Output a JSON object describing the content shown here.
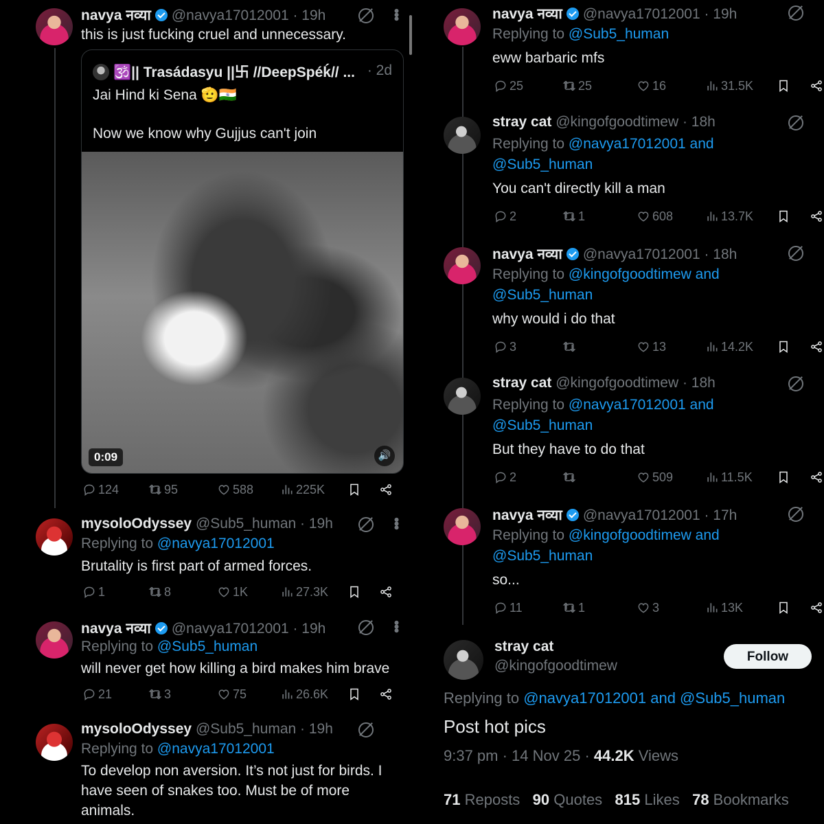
{
  "icons": {
    "reply": "reply-icon",
    "repost": "repost-icon",
    "like": "like-icon",
    "views": "views-icon",
    "bookmark": "bookmark-icon",
    "share": "share-icon",
    "grok": "grok-icon",
    "more": "more-icon"
  },
  "colors": {
    "background": "#000000",
    "text": "#e7e9ea",
    "muted": "#71767b",
    "link": "#1d9bf0",
    "verified": "#1d9bf0",
    "follow_button": "#eff3f4"
  },
  "left": {
    "post1": {
      "name": "navya नव्या",
      "handle": "@navya17012001 · 19h",
      "text": "this is just fucking cruel and unnecessary.",
      "quote": {
        "author": "🕉️|| Trasádasyu ||卐 //DeepSpéḱ// ...",
        "time": "· 2d",
        "text_line1": "Jai Hind ki Sena 🫡🇮🇳",
        "text_line2": "Now we know why Gujjus can't join",
        "video_time": "0:09"
      },
      "stats": {
        "replies": "124",
        "reposts": "95",
        "likes": "588",
        "views": "225K"
      }
    },
    "post2": {
      "name": "mysoloOdyssey",
      "handle": "@Sub5_human · 19h",
      "replying_label": "Replying to",
      "replying_to": "@navya17012001",
      "text": "Brutality is first part of armed forces.",
      "stats": {
        "replies": "1",
        "reposts": "8",
        "likes": "1K",
        "views": "27.3K"
      }
    },
    "post3": {
      "name": "navya नव्या",
      "handle": "@navya17012001 · 19h",
      "replying_label": "Replying to",
      "replying_to": "@Sub5_human",
      "text": "will never get how killing a bird makes him brave",
      "stats": {
        "replies": "21",
        "reposts": "3",
        "likes": "75",
        "views": "26.6K"
      }
    },
    "post4": {
      "name": "mysoloOdyssey",
      "handle": "@Sub5_human · 19h",
      "replying_label": "Replying to",
      "replying_to": "@navya17012001",
      "text_line1": "To develop non aversion. It’s not just for birds. I",
      "text_line2": "have seen of snakes too. Must be of more",
      "text_line3": "animals."
    }
  },
  "right": {
    "post1": {
      "name": "navya नव्या",
      "handle": "@navya17012001 · 19h",
      "replying_label": "Replying to",
      "replying_to": "@Sub5_human",
      "text": "eww barbaric mfs",
      "stats": {
        "replies": "25",
        "reposts": "25",
        "likes": "16",
        "views": "31.5K"
      }
    },
    "post2": {
      "name": "stray cat",
      "handle": "@kingofgoodtimew · 18h",
      "replying_label": "Replying to",
      "replying_to_line1": "@navya17012001 and",
      "replying_to_line2": "@Sub5_human",
      "text": "You can't directly kill a man",
      "stats": {
        "replies": "2",
        "reposts": "1",
        "likes": "608",
        "views": "13.7K"
      }
    },
    "post3": {
      "name": "navya नव्या",
      "handle": "@navya17012001 · 18h",
      "replying_label": "Replying to",
      "replying_to_line1": "@kingofgoodtimew and",
      "replying_to_line2": "@Sub5_human",
      "text": "why would i do that",
      "stats": {
        "replies": "3",
        "reposts": "",
        "likes": "13",
        "views": "14.2K"
      }
    },
    "post4": {
      "name": "stray cat",
      "handle": "@kingofgoodtimew · 18h",
      "replying_label": "Replying to",
      "replying_to_line1": "@navya17012001 and",
      "replying_to_line2": "@Sub5_human",
      "text": "But they have to do that",
      "stats": {
        "replies": "2",
        "reposts": "",
        "likes": "509",
        "views": "11.5K"
      }
    },
    "post5": {
      "name": "navya नव्या",
      "handle": "@navya17012001 · 17h",
      "replying_label": "Replying to",
      "replying_to_line1": "@kingofgoodtimew and",
      "replying_to_line2": "@Sub5_human",
      "text": "so...",
      "stats": {
        "replies": "11",
        "reposts": "1",
        "likes": "3",
        "views": "13K"
      }
    },
    "main": {
      "name": "stray cat",
      "handle": "@kingofgoodtimew",
      "follow_label": "Follow",
      "replying_label": "Replying to",
      "replying_to": "@navya17012001 and @Sub5_human",
      "text": "Post hot pics",
      "timestamp": "9:37 pm · 14 Nov 25 · ",
      "views_count": "44.2K",
      "views_label": " Views",
      "reposts_count": "71",
      "reposts_label": " Reposts",
      "quotes_count": "90",
      "quotes_label": " Quotes",
      "likes_count": "815",
      "likes_label": " Likes",
      "bookmarks_count": "78",
      "bookmarks_label": " Bookmarks"
    }
  }
}
